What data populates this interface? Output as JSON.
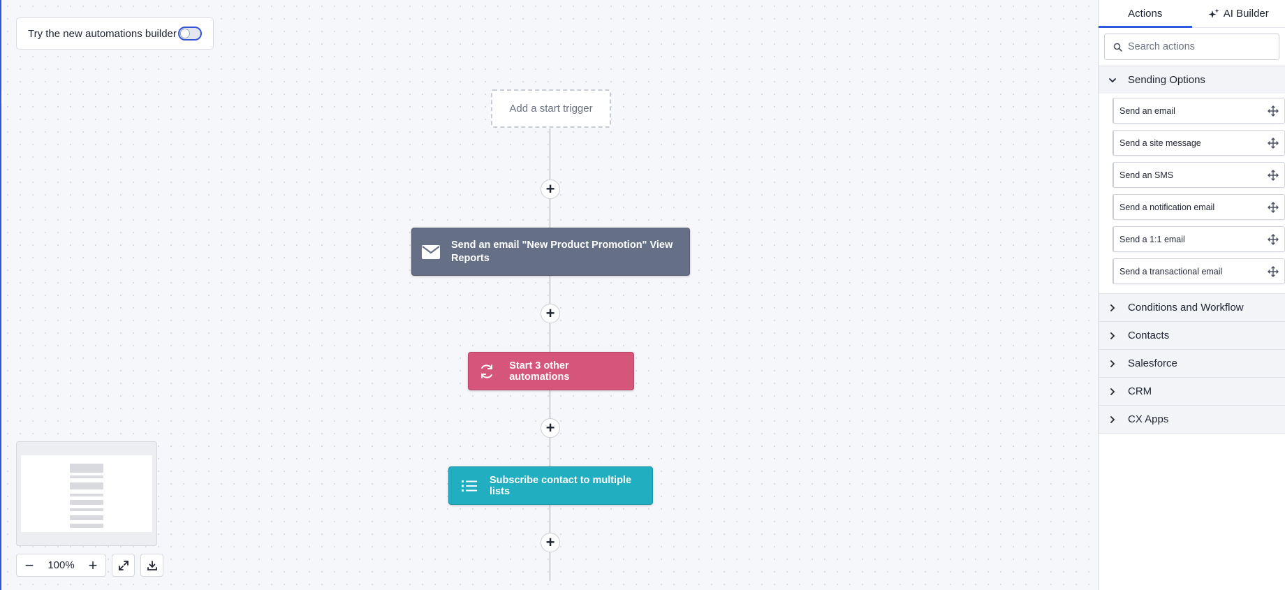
{
  "canvas": {
    "builder_toggle": {
      "label": "Try the new automations builder",
      "enabled": false
    },
    "trigger": {
      "label": "Add a start trigger"
    },
    "nodes": [
      {
        "label": "Send an email \"New Product Promotion\" View Reports",
        "icon": "envelope-icon",
        "color": "#657087"
      },
      {
        "label": "Start 3 other automations",
        "icon": "refresh-icon",
        "color": "#d6557a"
      },
      {
        "label": "Subscribe contact to multiple lists",
        "icon": "list-icon",
        "color": "#21aec0"
      }
    ],
    "add_step_symbol": "+",
    "zoom": {
      "value": "100%",
      "minus": "−",
      "plus": "+"
    }
  },
  "panel": {
    "tabs": [
      {
        "label": "Actions",
        "active": true
      },
      {
        "label": "AI Builder",
        "icon": "sparkle-icon",
        "active": false
      }
    ],
    "search": {
      "placeholder": "Search actions",
      "value": ""
    },
    "sections": [
      {
        "title": "Sending Options",
        "expanded": true,
        "items": [
          "Send an email",
          "Send a site message",
          "Send an SMS",
          "Send a notification email",
          "Send a 1:1 email",
          "Send a transactional email"
        ]
      },
      {
        "title": "Conditions and Workflow",
        "expanded": false
      },
      {
        "title": "Contacts",
        "expanded": false
      },
      {
        "title": "Salesforce",
        "expanded": false
      },
      {
        "title": "CRM",
        "expanded": false
      },
      {
        "title": "CX Apps",
        "expanded": false
      }
    ]
  },
  "colors": {
    "accent": "#2d5ae0"
  }
}
